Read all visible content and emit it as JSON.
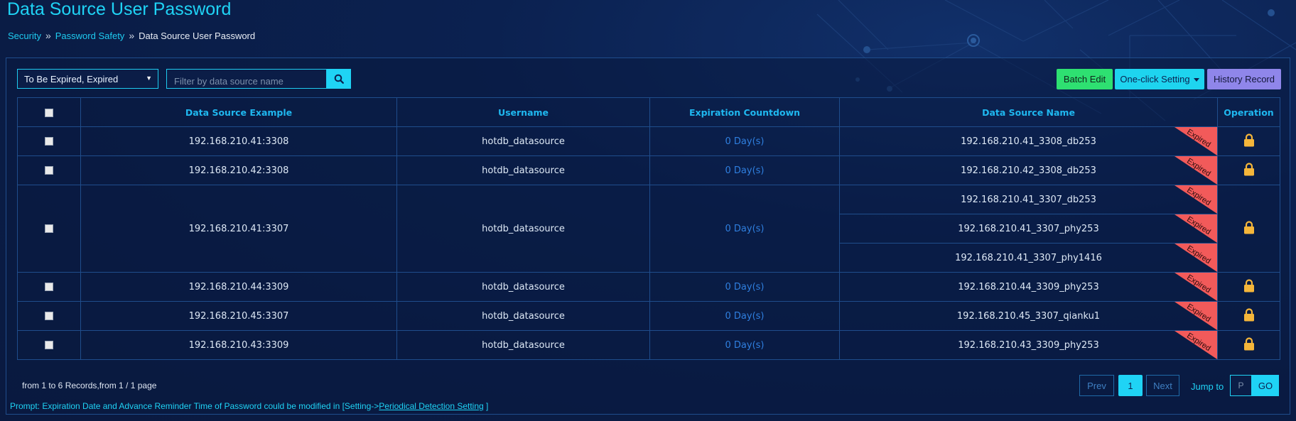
{
  "page": {
    "title": "Data Source User Password",
    "breadcrumb": [
      "Security",
      "Password Safety",
      "Data Source User Password"
    ]
  },
  "toolbar": {
    "status_filter": "To Be Expired, Expired",
    "search_placeholder": "Filter by data source name",
    "batch_edit": "Batch Edit",
    "one_click_setting": "One-click Setting",
    "history_record": "History Record"
  },
  "table": {
    "headers": [
      "Data Source Example",
      "Username",
      "Expiration Countdown",
      "Data Source Name",
      "Operation"
    ],
    "rows": [
      {
        "example": "192.168.210.41:3308",
        "username": "hotdb_datasource",
        "countdown": "0 Day(s)",
        "names": [
          "192.168.210.41_3308_db253"
        ]
      },
      {
        "example": "192.168.210.42:3308",
        "username": "hotdb_datasource",
        "countdown": "0 Day(s)",
        "names": [
          "192.168.210.42_3308_db253"
        ]
      },
      {
        "example": "192.168.210.41:3307",
        "username": "hotdb_datasource",
        "countdown": "0 Day(s)",
        "names": [
          "192.168.210.41_3307_db253",
          "192.168.210.41_3307_phy253",
          "192.168.210.41_3307_phy1416"
        ]
      },
      {
        "example": "192.168.210.44:3309",
        "username": "hotdb_datasource",
        "countdown": "0 Day(s)",
        "names": [
          "192.168.210.44_3309_phy253"
        ]
      },
      {
        "example": "192.168.210.45:3307",
        "username": "hotdb_datasource",
        "countdown": "0 Day(s)",
        "names": [
          "192.168.210.45_3307_qianku1"
        ]
      },
      {
        "example": "192.168.210.43:3309",
        "username": "hotdb_datasource",
        "countdown": "0 Day(s)",
        "names": [
          "192.168.210.43_3309_phy253"
        ]
      }
    ],
    "status_tag": "Expired"
  },
  "pagination": {
    "summary": "from 1 to 6 Records,from 1 / 1 page",
    "prev": "Prev",
    "current": "1",
    "next": "Next",
    "jump_label": "Jump to",
    "jump_placeholder": "P",
    "go": "GO"
  },
  "prompt": {
    "text": "Prompt: Expiration Date and Advance Reminder Time of Password could be modified in [Setting->",
    "link": "Periodical Detection Setting",
    "suffix": " ]"
  },
  "colors": {
    "accent": "#1fd3f5",
    "batch_edit": "#2ee071",
    "history": "#8f86ea",
    "expired_tag": "#f25a5a",
    "lock": "#f5b63a"
  }
}
